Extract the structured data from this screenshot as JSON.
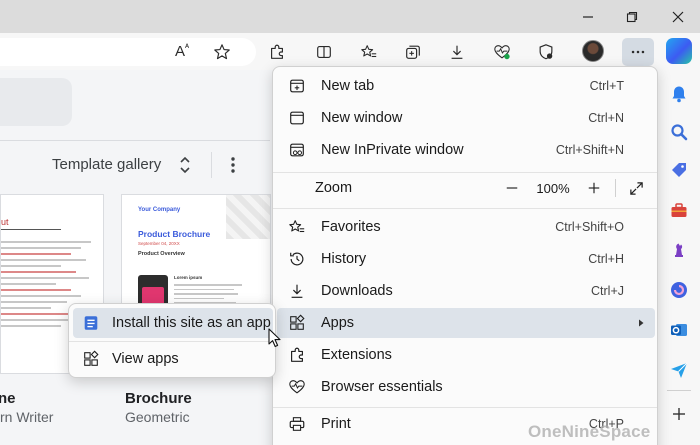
{
  "toolbar": {
    "read_aloud_glyph": "A",
    "read_aloud_superscript": "ᴬ"
  },
  "page": {
    "gallery_label": "Template gallery",
    "templates": [
      {
        "title": "ne",
        "subtitle": "rn Writer"
      },
      {
        "title": "Brochure",
        "subtitle": "Geometric"
      }
    ],
    "brochure_thumb": {
      "company": "Your Company",
      "heading": "Product Brochure",
      "date": "September 04, 20XX",
      "section": "Product Overview",
      "lorem": "Lorem ipsum"
    },
    "resume_thumb": {
      "heading": "ut"
    }
  },
  "menu": {
    "items": [
      {
        "label": "New tab",
        "shortcut": "Ctrl+T"
      },
      {
        "label": "New window",
        "shortcut": "Ctrl+N"
      },
      {
        "label": "New InPrivate window",
        "shortcut": "Ctrl+Shift+N"
      },
      {
        "label": "Zoom",
        "value": "100%"
      },
      {
        "label": "Favorites",
        "shortcut": "Ctrl+Shift+O"
      },
      {
        "label": "History",
        "shortcut": "Ctrl+H"
      },
      {
        "label": "Downloads",
        "shortcut": "Ctrl+J"
      },
      {
        "label": "Apps"
      },
      {
        "label": "Extensions"
      },
      {
        "label": "Browser essentials"
      },
      {
        "label": "Print",
        "shortcut": "Ctrl+P"
      }
    ]
  },
  "submenu": {
    "items": [
      {
        "label": "Install this site as an app"
      },
      {
        "label": "View apps"
      }
    ]
  },
  "watermark": "OneNineSpace",
  "colors": {
    "highlight": "#dde3ea",
    "titlebar": "#dcdcdc",
    "accent_blue": "#3b5bdb"
  }
}
